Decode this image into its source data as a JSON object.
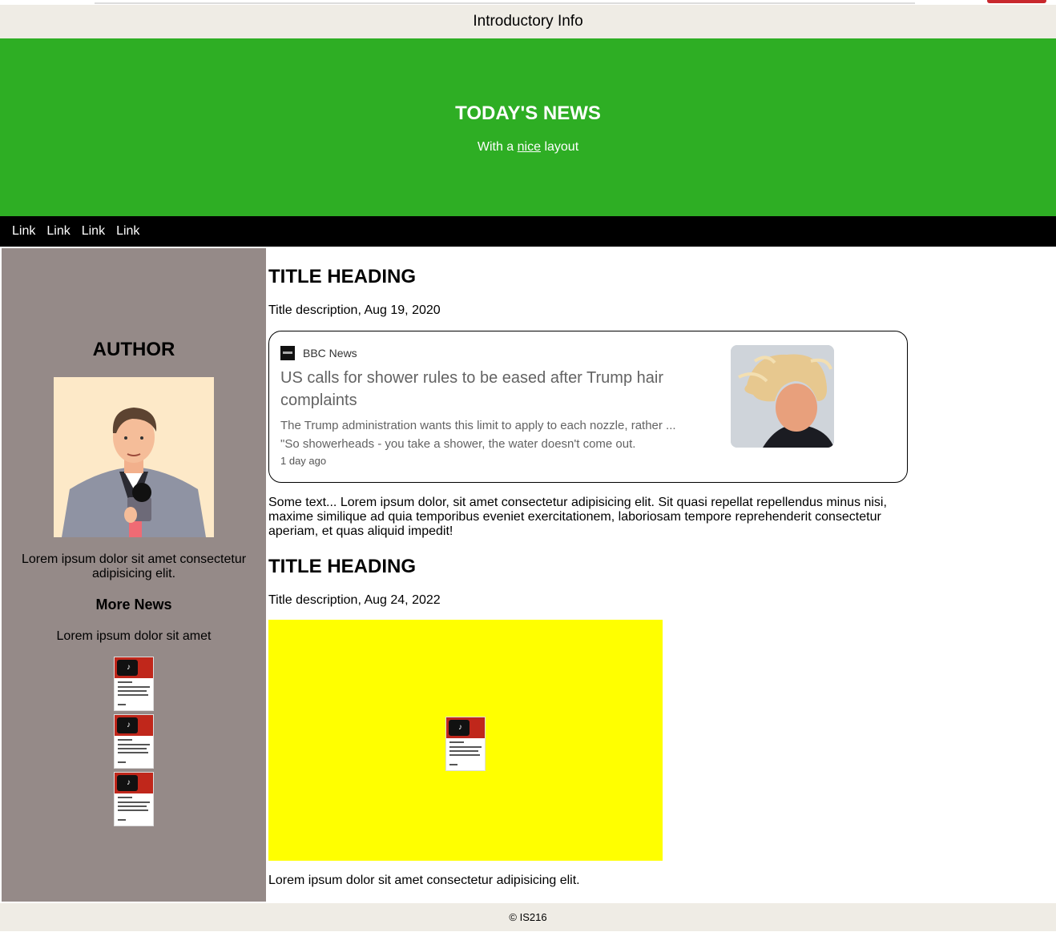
{
  "infobar": {
    "title": "Introductory Info"
  },
  "hero": {
    "title": "TODAY'S NEWS",
    "subtitle_before": "With a ",
    "subtitle_link": "nice",
    "subtitle_after": " layout"
  },
  "nav": {
    "links": [
      "Link",
      "Link",
      "Link",
      "Link"
    ]
  },
  "sidebar": {
    "heading": "AUTHOR",
    "bio": "Lorem ipsum dolor sit amet consectetur adipisicing elit.",
    "more_heading": "More News",
    "more_text": "Lorem ipsum dolor sit amet"
  },
  "main": {
    "article1": {
      "title": "TITLE HEADING",
      "description": "Title description, Aug 19, 2020",
      "card": {
        "source": "BBC News",
        "headline": "US calls for shower rules to be eased after Trump hair complaints",
        "snippet_line1": "The Trump administration wants this limit to apply to each nozzle, rather ...",
        "snippet_line2": "\"So showerheads - you take a shower, the water doesn't come out.",
        "time": "1 day ago"
      },
      "body": "Some text... Lorem ipsum dolor, sit amet consectetur adipisicing elit. Sit quasi repellat repellendus minus nisi, maxime similique ad quia temporibus eveniet exercitationem, laboriosam tempore reprehenderit consectetur aperiam, et quas aliquid impedit!"
    },
    "article2": {
      "title": "TITLE HEADING",
      "description": "Title description, Aug 24, 2022",
      "body": "Lorem ipsum dolor sit amet consectetur adipisicing elit."
    }
  },
  "footer": {
    "text": "© IS216"
  },
  "colors": {
    "hero": "#2eae24",
    "sidebar": "#958a88",
    "highlight": "#ffff00",
    "bars": "#efece5"
  }
}
